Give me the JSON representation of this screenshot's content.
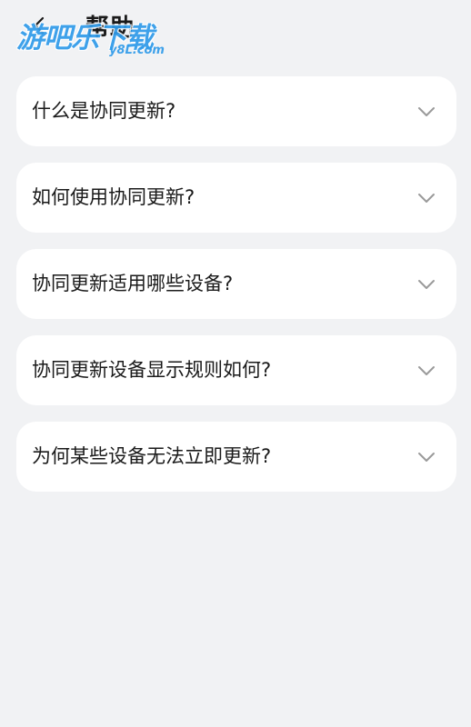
{
  "header": {
    "title": "帮助",
    "back_icon": "back-arrow-icon"
  },
  "watermark": {
    "text": "游吧乐下载",
    "sub": "y8L.com"
  },
  "faq": {
    "items": [
      {
        "label": "什么是协同更新?"
      },
      {
        "label": "如何使用协同更新?"
      },
      {
        "label": "协同更新适用哪些设备?"
      },
      {
        "label": "协同更新设备显示规则如何?"
      },
      {
        "label": "为何某些设备无法立即更新?"
      }
    ],
    "chevron_icon": "chevron-down-icon"
  },
  "colors": {
    "background": "#f1f2f4",
    "card": "#ffffff",
    "text": "#1a1a1a",
    "chevron": "#9a9a9a",
    "watermark": "#2f9bea"
  }
}
